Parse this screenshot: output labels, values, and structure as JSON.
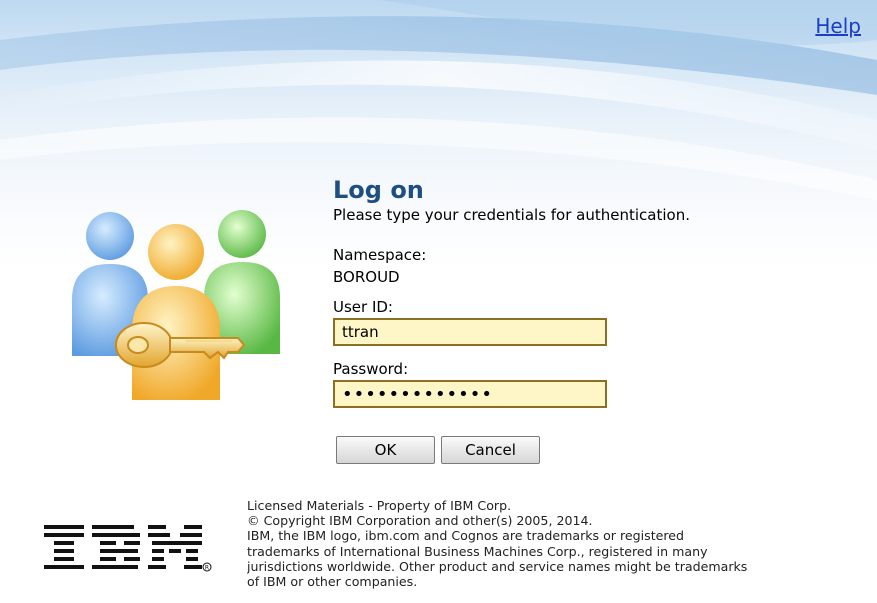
{
  "header": {
    "help_label": "Help"
  },
  "form": {
    "title": "Log on",
    "subtitle": "Please type your credentials for authentication.",
    "namespace_label": "Namespace:",
    "namespace_value": "BOROUD",
    "userid_label": "User ID:",
    "userid_value": "ttran",
    "password_label": "Password:",
    "password_value": "•••••••••••••",
    "ok_label": "OK",
    "cancel_label": "Cancel"
  },
  "footer": {
    "logo_text": "IBM",
    "legal_lines": [
      "Licensed Materials - Property of IBM Corp.",
      "© Copyright IBM Corporation and other(s) 2005, 2014.",
      "IBM, the IBM logo, ibm.com and Cognos are trademarks or registered",
      "trademarks of International Business Machines Corp., registered in many",
      "jurisdictions worldwide. Other product and service names might be trademarks",
      "of IBM or other companies."
    ]
  },
  "colors": {
    "title": "#1e4f83",
    "help_link": "#1a3ec8",
    "input_bg": "#fff6c8",
    "input_border": "#8b6f22"
  }
}
